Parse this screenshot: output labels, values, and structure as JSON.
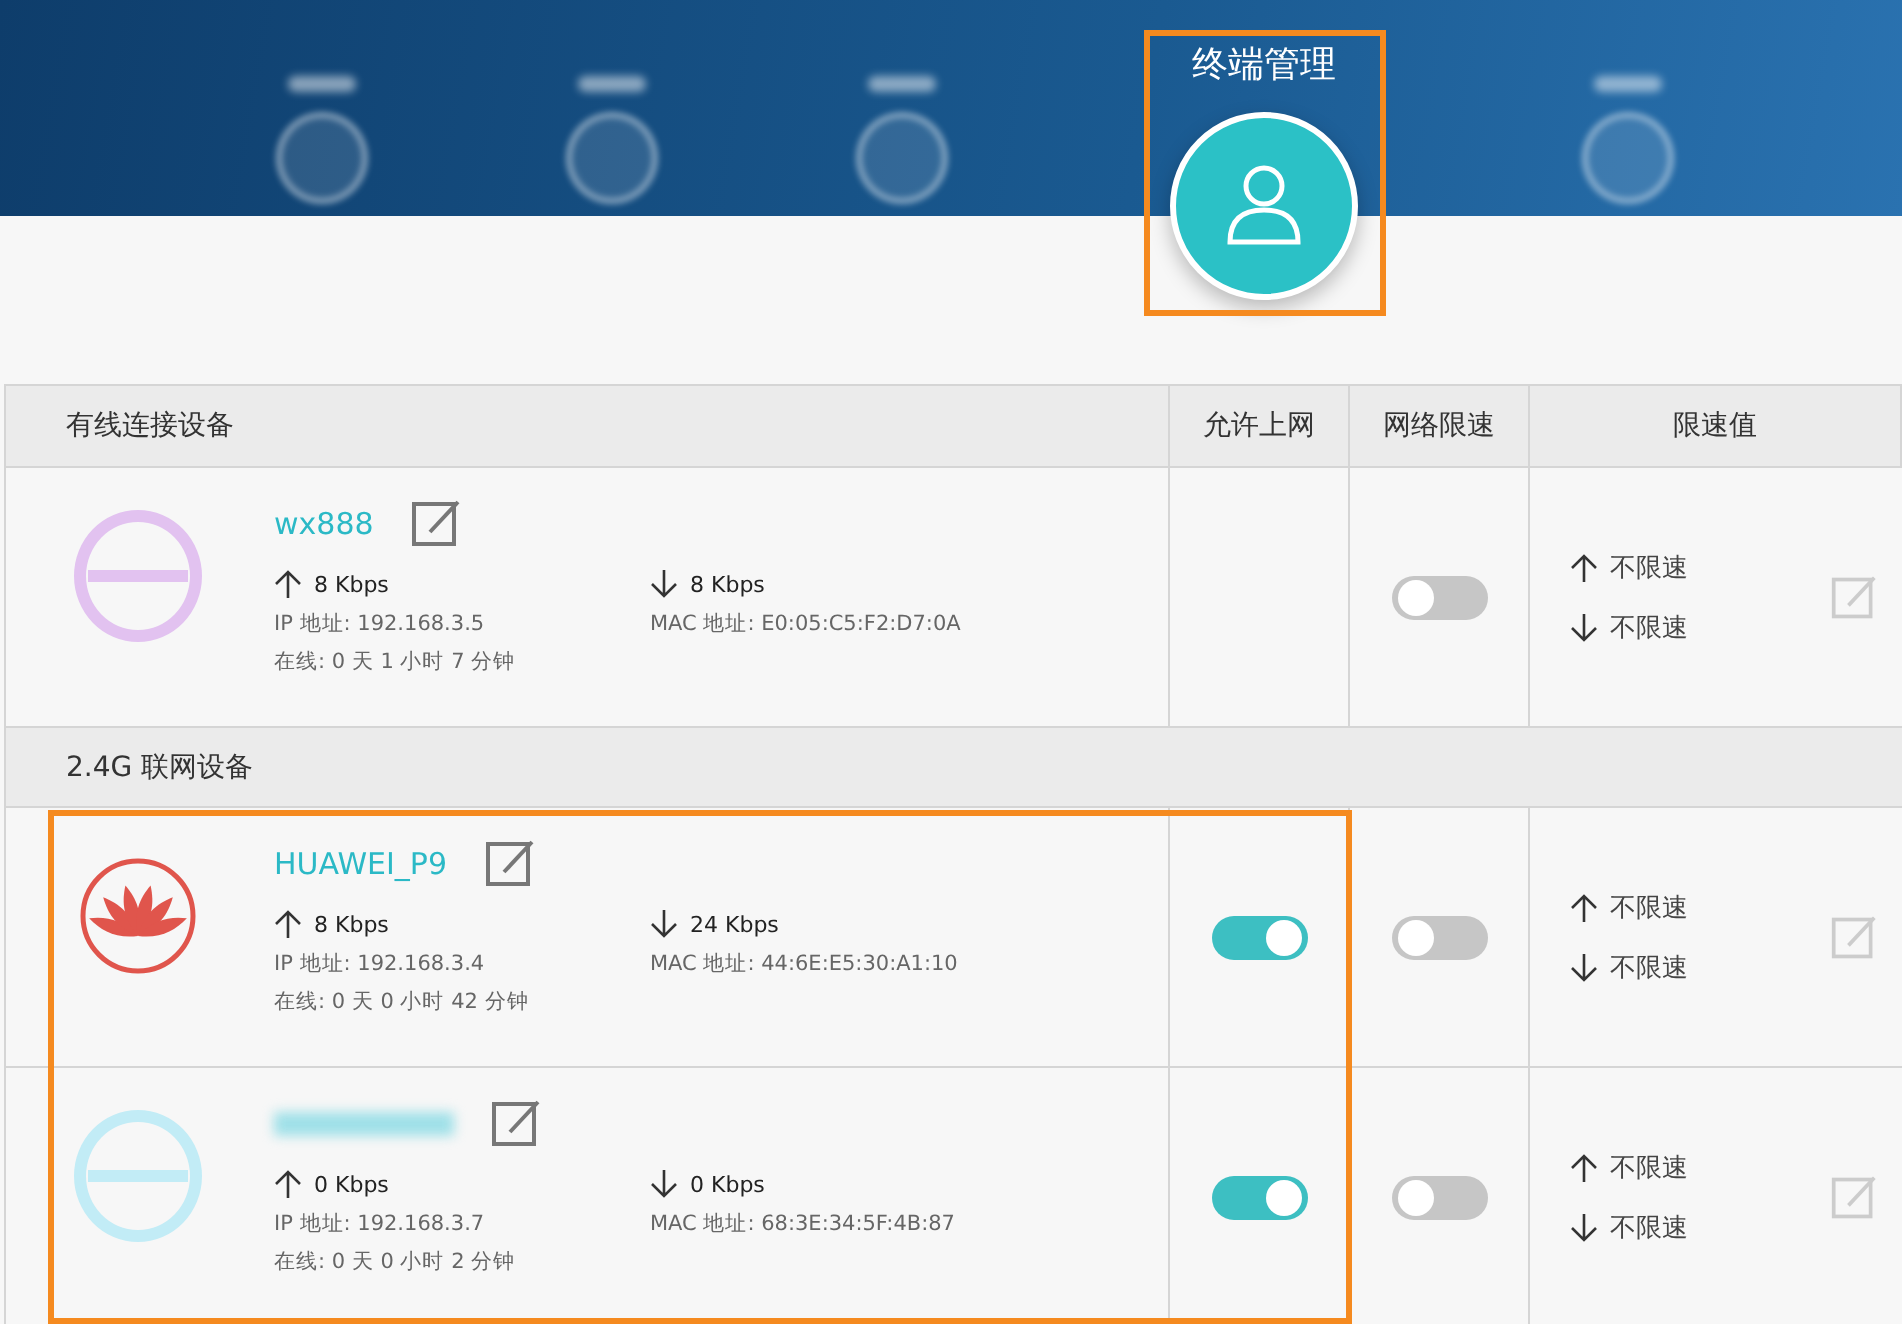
{
  "nav": [
    {
      "selected": false
    },
    {
      "selected": false
    },
    {
      "selected": false
    },
    {
      "label": "终端管理",
      "selected": true
    },
    {
      "selected": false
    }
  ],
  "table": {
    "columns": [
      "有线连接设备",
      "允许上网",
      "网络限速",
      "限速值"
    ],
    "sections": [
      {
        "highlighted": false,
        "devices": [
          {
            "name": "wx888",
            "kind": "blurred",
            "color": "#e2c2f0",
            "up": "8 Kbps",
            "down": "8 Kbps",
            "ip": "IP 地址: 192.168.3.5",
            "mac": "MAC 地址: E0:05:C5:F2:D7:0A",
            "online": "在线:  0 天 1 小时 7 分钟",
            "limit_on": false,
            "up_limit": "不限速",
            "down_limit": "不限速"
          }
        ]
      },
      {
        "title": "2.4G 联网设备",
        "highlighted": true,
        "devices": [
          {
            "name": "HUAWEI_P9",
            "kind": "logo",
            "color": "#e0554c",
            "up": "8 Kbps",
            "down": "24 Kbps",
            "ip": "IP 地址: 192.168.3.4",
            "mac": "MAC 地址: 44:6E:E5:30:A1:10",
            "online": "在线:  0 天 0 小时 42 分钟",
            "allow_on": true,
            "limit_on": false,
            "up_limit": "不限速",
            "down_limit": "不限速"
          },
          {
            "kind": "blurred",
            "color": "#c2ecf6",
            "up": "0 Kbps",
            "down": "0 Kbps",
            "ip": "IP 地址: 192.168.3.7",
            "mac": "MAC 地址: 68:3E:34:5F:4B:87",
            "online": "在线:  0 天 0 小时 2 分钟",
            "allow_on": true,
            "limit_on": false,
            "up_limit": "不限速",
            "down_limit": "不限速"
          }
        ]
      }
    ]
  }
}
